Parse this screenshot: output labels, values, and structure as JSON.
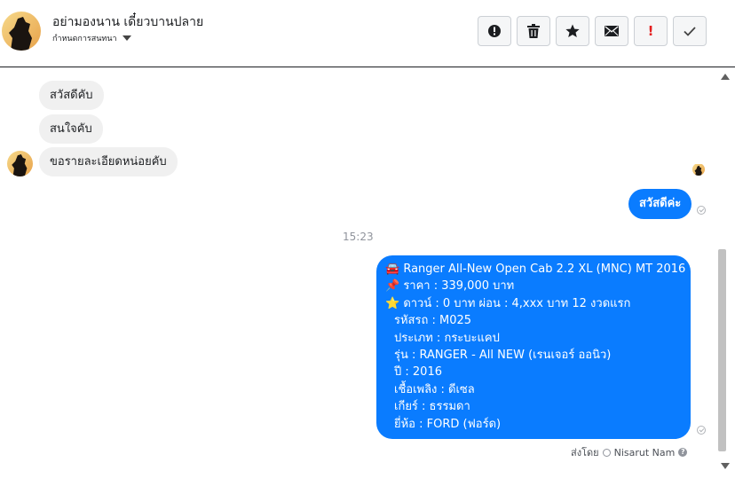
{
  "header": {
    "contact_name": "อย่ามองนาน เดี๋ยวบานปลาย",
    "contact_subtitle": "กำหนดการสนทนา"
  },
  "toolbar": {
    "buttons": [
      {
        "name": "alert-circle",
        "icon": "exclamation-circle-icon"
      },
      {
        "name": "delete",
        "icon": "trash-icon"
      },
      {
        "name": "star",
        "icon": "star-icon"
      },
      {
        "name": "mail",
        "icon": "envelope-icon"
      },
      {
        "name": "important",
        "icon": "exclamation-icon",
        "label": "!"
      },
      {
        "name": "done",
        "icon": "checkmark-icon"
      }
    ]
  },
  "messages": {
    "incoming": [
      {
        "text": "สวัสดีคับ"
      },
      {
        "text": "สนใจคับ"
      },
      {
        "text": "ขอรายละเอียดหน่อยคับ"
      }
    ],
    "outgoing_short": {
      "text": "สวัสดีค่ะ"
    },
    "timestamp": "15:23",
    "outgoing_long": {
      "lines": [
        "🚘 Ranger All-New Open Cab 2.2 XL (MNC) MT 2016",
        "📌 ราคา : 339,000 บาท",
        "⭐ ดาวน์ : 0 บาท ผ่อน : 4,xxx บาท 12 งวดแรก",
        "รหัสรถ : M025",
        "ประเภท : กระบะแคป",
        "รุ่น : RANGER - All NEW (เรนเจอร์ ออนิว)",
        "ปี : 2016",
        "เชื้อเพลิง : ดีเซล",
        "เกียร์ : ธรรมดา",
        "ยี่ห้อ : FORD (ฟอร์ด)"
      ]
    },
    "sent_by_label": "ส่งโดย",
    "sent_by_name": "Nisarut Nam",
    "help_label": "?"
  },
  "colors": {
    "outgoing_bubble": "#0a7cff",
    "incoming_bubble": "#f0f0f0",
    "alert_red": "#e41e1e"
  }
}
